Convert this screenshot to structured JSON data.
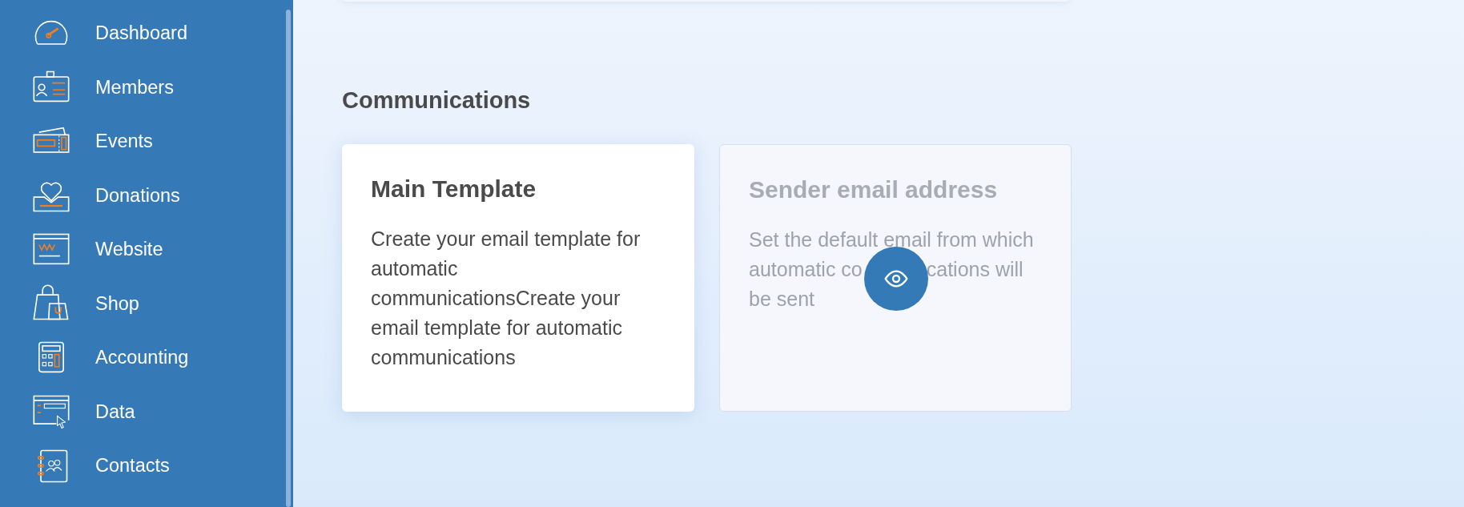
{
  "sidebar": {
    "items": [
      {
        "label": "Dashboard"
      },
      {
        "label": "Members"
      },
      {
        "label": "Events"
      },
      {
        "label": "Donations"
      },
      {
        "label": "Website"
      },
      {
        "label": "Shop"
      },
      {
        "label": "Accounting"
      },
      {
        "label": "Data"
      },
      {
        "label": "Contacts"
      }
    ]
  },
  "section": {
    "title": "Communications",
    "cards": [
      {
        "title": "Main Template",
        "description": [
          [
            "Create your email template for automatic communicationsCreate your email template for automatic communications"
          ]
        ],
        "disabled": false,
        "preview": false
      },
      {
        "title": "Sender email address",
        "description": [
          [
            "Set the default email from which"
          ],
          [
            "automatic co",
            "cations will"
          ],
          [
            "be sent"
          ]
        ],
        "disabled": true,
        "preview": true
      }
    ]
  }
}
